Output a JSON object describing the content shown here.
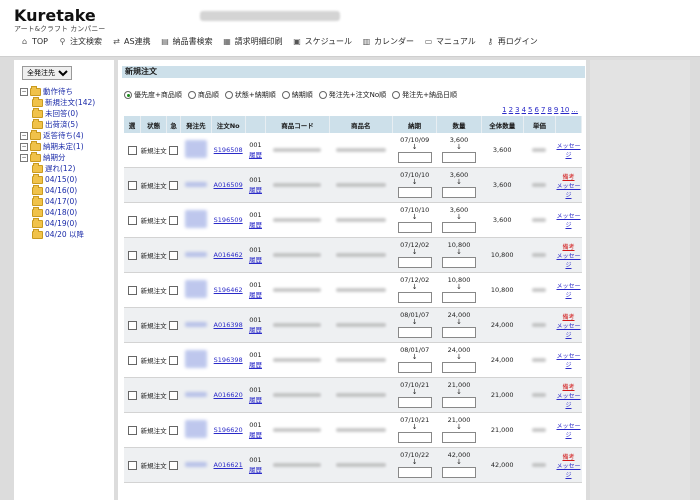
{
  "logo": {
    "text": "Kuretake",
    "subtext": "アート&クラフト カンパニー"
  },
  "topnav": [
    {
      "label": "TOP",
      "icon": "home-icon"
    },
    {
      "label": "注文検索",
      "icon": "magnifier-icon"
    },
    {
      "label": "AS連携",
      "icon": "link-icon"
    },
    {
      "label": "納品書検索",
      "icon": "document-search-icon"
    },
    {
      "label": "請求明細印刷",
      "icon": "printer-icon"
    },
    {
      "label": "スケジュール",
      "icon": "schedule-icon"
    },
    {
      "label": "カレンダー",
      "icon": "calendar-icon"
    },
    {
      "label": "マニュアル",
      "icon": "manual-icon"
    },
    {
      "label": "再ログイン",
      "icon": "key-icon"
    }
  ],
  "sidebar": {
    "select_value": "全発注先",
    "tree": [
      {
        "label": "動作待ち",
        "level": 0,
        "toggle": "−"
      },
      {
        "label": "新規注文(142)",
        "level": 1
      },
      {
        "label": "未回答(0)",
        "level": 1
      },
      {
        "label": "出荷済(5)",
        "level": 1
      },
      {
        "label": "返答待ち(4)",
        "level": 0
      },
      {
        "label": "納期未定(1)",
        "level": 0
      },
      {
        "label": "納期分",
        "level": 0,
        "toggle": "−"
      },
      {
        "label": "遅れ(12)",
        "level": 1
      },
      {
        "label": "04/15(0)",
        "level": 1
      },
      {
        "label": "04/16(0)",
        "level": 1
      },
      {
        "label": "04/17(0)",
        "level": 1
      },
      {
        "label": "04/18(0)",
        "level": 1
      },
      {
        "label": "04/19(0)",
        "level": 1
      },
      {
        "label": "04/20 以降",
        "level": 1
      }
    ]
  },
  "main": {
    "title": "新規注文",
    "sort_options": [
      {
        "label": "優先度+商品順",
        "selected": true
      },
      {
        "label": "商品順",
        "selected": false
      },
      {
        "label": "状態+納期順",
        "selected": false
      },
      {
        "label": "納期順",
        "selected": false
      },
      {
        "label": "発注先+注文No順",
        "selected": false
      },
      {
        "label": "発注先+納品日順",
        "selected": false
      }
    ],
    "pager": [
      "1",
      "2",
      "3",
      "4",
      "5",
      "6",
      "7",
      "8",
      "9",
      "10",
      "..."
    ],
    "columns": [
      "選",
      "状態",
      "急",
      "発注先",
      "注文No",
      "",
      "商品コード",
      "商品名",
      "納期",
      "数量",
      "全体数量",
      "単価",
      ""
    ],
    "rows": [
      {
        "status": "新規注文",
        "order_no": "S196508",
        "line": "001",
        "history": "履歴",
        "date": "07/10/09",
        "qty": "3,600",
        "total": "3,600",
        "memo": ""
      },
      {
        "status": "新規注文",
        "order_no": "A016509",
        "line": "001",
        "history": "履歴",
        "date": "07/10/10",
        "qty": "3,600",
        "total": "3,600",
        "memo": "備考"
      },
      {
        "status": "新規注文",
        "order_no": "S196509",
        "line": "001",
        "history": "履歴",
        "date": "07/10/10",
        "qty": "3,600",
        "total": "3,600",
        "memo": ""
      },
      {
        "status": "新規注文",
        "order_no": "A016462",
        "line": "001",
        "history": "履歴",
        "date": "07/12/02",
        "qty": "10,800",
        "total": "10,800",
        "memo": "備考"
      },
      {
        "status": "新規注文",
        "order_no": "S196462",
        "line": "001",
        "history": "履歴",
        "date": "07/12/02",
        "qty": "10,800",
        "total": "10,800",
        "memo": ""
      },
      {
        "status": "新規注文",
        "order_no": "A016398",
        "line": "001",
        "history": "履歴",
        "date": "08/01/07",
        "qty": "24,000",
        "total": "24,000",
        "memo": "備考"
      },
      {
        "status": "新規注文",
        "order_no": "S196398",
        "line": "001",
        "history": "履歴",
        "date": "08/01/07",
        "qty": "24,000",
        "total": "24,000",
        "memo": ""
      },
      {
        "status": "新規注文",
        "order_no": "A016620",
        "line": "001",
        "history": "履歴",
        "date": "07/10/21",
        "qty": "21,000",
        "total": "21,000",
        "memo": "備考"
      },
      {
        "status": "新規注文",
        "order_no": "S196620",
        "line": "001",
        "history": "履歴",
        "date": "07/10/21",
        "qty": "21,000",
        "total": "21,000",
        "memo": ""
      },
      {
        "status": "新規注文",
        "order_no": "A016621",
        "line": "001",
        "history": "履歴",
        "date": "07/10/22",
        "qty": "42,000",
        "total": "42,000",
        "memo": "備考"
      }
    ],
    "message_label": "メッセージ",
    "arrow_glyph": "↓"
  },
  "colors": {
    "header_bg": "#cde0ea",
    "link": "#2a2ac8",
    "memo_red": "#d21a1a",
    "folder": "#f0c24a"
  }
}
